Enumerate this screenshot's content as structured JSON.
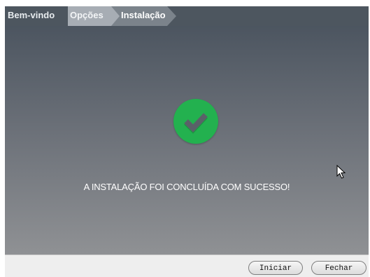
{
  "breadcrumb": {
    "steps": [
      {
        "label": "Bem-vindo"
      },
      {
        "label": "Opções"
      },
      {
        "label": "Instalação"
      }
    ]
  },
  "main": {
    "success_icon": "checkmark-circle-icon",
    "success_message": "A INSTALAÇÃO FOI CONCLUÍDA COM SUCESSO!"
  },
  "footer": {
    "start_label": "Iniciar",
    "close_label": "Fechar"
  },
  "colors": {
    "header_bg": "#4d565f",
    "success_green": "#23b14f",
    "active_step_bg": "#7b838b"
  }
}
